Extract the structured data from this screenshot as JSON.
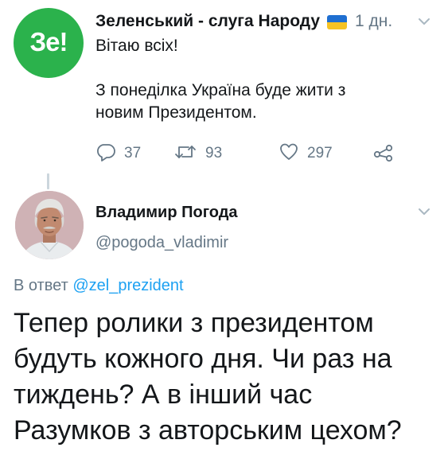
{
  "parent_tweet": {
    "avatar_text": "Зе!",
    "author_name": "Зеленський - слуга Народу",
    "time": "1 дн.",
    "text_lines": [
      "Вітаю всіх!",
      "",
      "З понеділка Україна буде жити з",
      "новим Президентом."
    ],
    "stats": {
      "replies": "37",
      "retweets": "93",
      "likes": "297"
    },
    "colors": {
      "avatar_bg": "#2bb24c",
      "flag_blue": "#1f6fd1",
      "flag_yellow": "#f6c324"
    }
  },
  "reply_tweet": {
    "author_name": "Владимир Погода",
    "handle": "@pogoda_vladimir",
    "in_reply_prefix": "В ответ",
    "in_reply_mention": "@zel_prezident",
    "text_lines": [
      "Тепер ролики з президентом",
      "будуть кожного дня. Чи раз на",
      "тиждень? А в інший час",
      "Разумков з авторським цехом?"
    ]
  },
  "icons": [
    "reply-icon",
    "retweet-icon",
    "like-icon",
    "share-icon",
    "chevron-down-icon"
  ],
  "colors": {
    "text": "#14171a",
    "muted": "#657786",
    "link": "#1da1f2"
  }
}
